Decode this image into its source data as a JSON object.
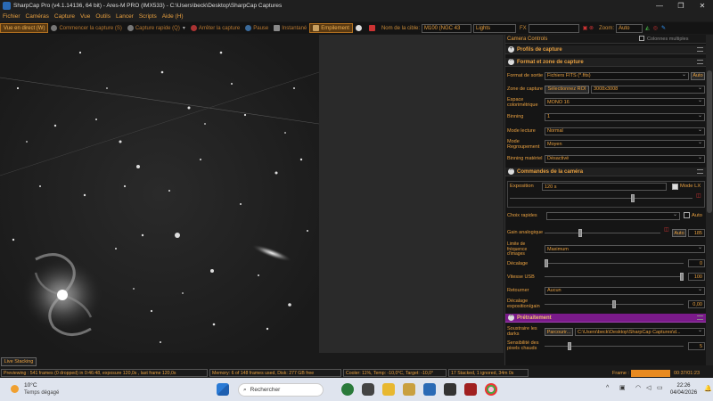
{
  "window": {
    "title": "SharpCap Pro (v4.1.14136, 64 bit) - Ares-M PRO (IMX533) - C:\\Users\\beck\\Desktop\\SharpCap Captures",
    "controls": [
      "—",
      "❐",
      "✕"
    ]
  },
  "menu": [
    "Fichier",
    "Caméras",
    "Capture",
    "Vue",
    "Outils",
    "Lancer",
    "Scripts",
    "Aide (H)"
  ],
  "toolbar": {
    "live_view": "Vue en direct (W)",
    "start_capture": "Commencer la capture (S)",
    "quick_capture": "Capture rapide (Q)",
    "stop_capture": "Arrêter la capture",
    "pause": "Pause",
    "snapshot": "Instantané",
    "stacking": "Empilement",
    "target_label": "Nom de la cible:",
    "target_value": "M100 (NGC 43",
    "frame_type": "Lights",
    "fx_label": "FX",
    "fx_value": "",
    "zoom_label": "Zoom:",
    "zoom_value": "Auto"
  },
  "panel": {
    "title": "Camera Controls",
    "multi_columns": "Colonnes multiples",
    "sections": {
      "profiles": "Profils de capture",
      "format": "Format et zone de capture",
      "camera": "Commandes de la caméra",
      "preprocessing": "Prétraitement"
    },
    "format": {
      "output_label": "Format de sortie",
      "output_value": "Fichiers FITS (*.fits)",
      "output_btn": "Auto",
      "zone_label": "Zone de capture",
      "zone_btn": "Sélectionnez ROI",
      "zone_value": "3008x3008",
      "color_label": "Espace colorimétrique",
      "color_value": "MONO 16",
      "binning_label": "Binning",
      "binning_value": "1",
      "read_label": "Mode lecture",
      "read_value": "Normal",
      "group_label": "Mode Regroupement",
      "group_value": "Moyen",
      "hwbin_label": "Binning matériel",
      "hwbin_value": "Désactivé"
    },
    "camera": {
      "exposure_label": "Exposition",
      "exposure_value": "120 s",
      "lx_label": "Mode LX",
      "quick_label": "Choix rapides",
      "auto_label": "Auto",
      "gain_label": "Gain analogique",
      "gain_auto": "Auto",
      "gain_value": "185",
      "fps_label": "Limite de fréquence d'images",
      "fps_value": "Maximum",
      "offset_label": "Décalage",
      "offset_value": "0",
      "usb_label": "Vitesse USB",
      "usb_value": "100",
      "flip_label": "Retourner",
      "flip_value": "Aucun",
      "expgain_label": "Décalage exposition/gain",
      "expgain_value": "0,00"
    },
    "pre": {
      "darks_label": "Soustraire les darks",
      "darks_btn": "Parcourir...",
      "darks_value": "C:\\Users\\beck\\Desktop\\SharpCap Captures\\d...",
      "hot_label": "Sensibilité des pixels chauds",
      "hot_value": "5"
    }
  },
  "livestack_tab": "Live Stacking",
  "status": {
    "preview": "Previewing : 541 frames (0 dropped) in 0:46:48, exposure 120,0s , last frame 120,0s",
    "memory": "Memory: 6 of 148 frames used, Disk: 277 GB free",
    "cooler": "Cooler: 11%, Temp: -10,0°C, Target: -10,0°",
    "stacked": "17 Stacked, 1 ignored, 34m 0s",
    "frame_label": "Frame :",
    "time": "00:37/01:23"
  },
  "taskbar": {
    "temp": "10°C",
    "weather": "Temps dégagé",
    "search": "Rechercher",
    "time": "22:26",
    "date": "04/04/2026"
  }
}
